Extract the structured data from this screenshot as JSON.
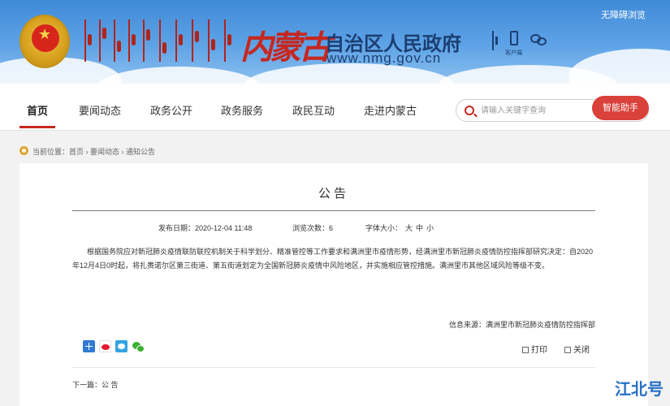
{
  "header": {
    "calligraphy": "内蒙古",
    "site_title": "自治区人民政府",
    "site_url": "www.nmg.gov.cn",
    "client_label": "客户端",
    "accessibility": "无障碍浏览",
    "emblem_icon": "national-emblem-icon",
    "accent_color": "#c6271f"
  },
  "nav": {
    "items": [
      {
        "label": "首页",
        "active": true
      },
      {
        "label": "要闻动态"
      },
      {
        "label": "政务公开"
      },
      {
        "label": "政务服务"
      },
      {
        "label": "政民互动"
      },
      {
        "label": "走进内蒙古"
      }
    ],
    "search_placeholder": "请输入关键字查询",
    "assistant_button": "智能助手",
    "assistant_color": "#d9413a"
  },
  "breadcrumb": {
    "prefix": "当前位置：",
    "items": [
      "首页",
      "要闻动态",
      "通知公告"
    ],
    "separator": " › "
  },
  "article": {
    "title": "公告",
    "publish_label": "发布日期：",
    "publish_date": "2020-12-04 11:48",
    "views_label": "浏览次数：",
    "views": "6",
    "font_label": "字体大小：",
    "font_sizes": [
      "大",
      "中",
      "小"
    ],
    "body": "根据国务院应对新冠肺炎疫情联防联控机制关于科学划分、精准管控等工作要求和满洲里市疫情形势，经满洲里市新冠肺炎疫情防控指挥部研究决定：自2020年12月4日0时起，将扎赉诺尔区第三街道、第五街道划定为全国新冠肺炎疫情中风险地区，并实施相应管控措施。满洲里市其他区域风险等级不变。",
    "source_label": "信息来源：",
    "source": "满洲里市新冠肺炎疫情防控指挥部",
    "print_label": "打印",
    "close_label": "关闭",
    "next_label": "下一篇：",
    "next_title": "公 告",
    "share_icons": [
      "share-plus-icon",
      "weibo-icon",
      "qq-icon",
      "wechat-icon"
    ]
  },
  "watermark": "江北号"
}
